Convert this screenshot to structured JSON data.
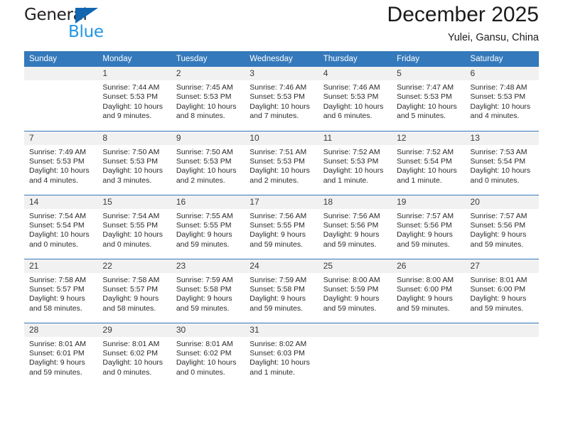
{
  "brand": {
    "name_top": "General",
    "name_bottom": "Blue",
    "accent_color": "#1266b0",
    "blue_text_color": "#2196e3"
  },
  "header": {
    "title": "December 2025",
    "subtitle": "Yulei, Gansu, China"
  },
  "calendar": {
    "header_bg": "#3479bb",
    "daynum_bg": "#f1f1f1",
    "weekday_headers": [
      "Sunday",
      "Monday",
      "Tuesday",
      "Wednesday",
      "Thursday",
      "Friday",
      "Saturday"
    ],
    "weeks": [
      [
        {
          "day": "",
          "sunrise": "",
          "sunset": "",
          "daylight1": "",
          "daylight2": ""
        },
        {
          "day": "1",
          "sunrise": "Sunrise: 7:44 AM",
          "sunset": "Sunset: 5:53 PM",
          "daylight1": "Daylight: 10 hours",
          "daylight2": "and 9 minutes."
        },
        {
          "day": "2",
          "sunrise": "Sunrise: 7:45 AM",
          "sunset": "Sunset: 5:53 PM",
          "daylight1": "Daylight: 10 hours",
          "daylight2": "and 8 minutes."
        },
        {
          "day": "3",
          "sunrise": "Sunrise: 7:46 AM",
          "sunset": "Sunset: 5:53 PM",
          "daylight1": "Daylight: 10 hours",
          "daylight2": "and 7 minutes."
        },
        {
          "day": "4",
          "sunrise": "Sunrise: 7:46 AM",
          "sunset": "Sunset: 5:53 PM",
          "daylight1": "Daylight: 10 hours",
          "daylight2": "and 6 minutes."
        },
        {
          "day": "5",
          "sunrise": "Sunrise: 7:47 AM",
          "sunset": "Sunset: 5:53 PM",
          "daylight1": "Daylight: 10 hours",
          "daylight2": "and 5 minutes."
        },
        {
          "day": "6",
          "sunrise": "Sunrise: 7:48 AM",
          "sunset": "Sunset: 5:53 PM",
          "daylight1": "Daylight: 10 hours",
          "daylight2": "and 4 minutes."
        }
      ],
      [
        {
          "day": "7",
          "sunrise": "Sunrise: 7:49 AM",
          "sunset": "Sunset: 5:53 PM",
          "daylight1": "Daylight: 10 hours",
          "daylight2": "and 4 minutes."
        },
        {
          "day": "8",
          "sunrise": "Sunrise: 7:50 AM",
          "sunset": "Sunset: 5:53 PM",
          "daylight1": "Daylight: 10 hours",
          "daylight2": "and 3 minutes."
        },
        {
          "day": "9",
          "sunrise": "Sunrise: 7:50 AM",
          "sunset": "Sunset: 5:53 PM",
          "daylight1": "Daylight: 10 hours",
          "daylight2": "and 2 minutes."
        },
        {
          "day": "10",
          "sunrise": "Sunrise: 7:51 AM",
          "sunset": "Sunset: 5:53 PM",
          "daylight1": "Daylight: 10 hours",
          "daylight2": "and 2 minutes."
        },
        {
          "day": "11",
          "sunrise": "Sunrise: 7:52 AM",
          "sunset": "Sunset: 5:53 PM",
          "daylight1": "Daylight: 10 hours",
          "daylight2": "and 1 minute."
        },
        {
          "day": "12",
          "sunrise": "Sunrise: 7:52 AM",
          "sunset": "Sunset: 5:54 PM",
          "daylight1": "Daylight: 10 hours",
          "daylight2": "and 1 minute."
        },
        {
          "day": "13",
          "sunrise": "Sunrise: 7:53 AM",
          "sunset": "Sunset: 5:54 PM",
          "daylight1": "Daylight: 10 hours",
          "daylight2": "and 0 minutes."
        }
      ],
      [
        {
          "day": "14",
          "sunrise": "Sunrise: 7:54 AM",
          "sunset": "Sunset: 5:54 PM",
          "daylight1": "Daylight: 10 hours",
          "daylight2": "and 0 minutes."
        },
        {
          "day": "15",
          "sunrise": "Sunrise: 7:54 AM",
          "sunset": "Sunset: 5:55 PM",
          "daylight1": "Daylight: 10 hours",
          "daylight2": "and 0 minutes."
        },
        {
          "day": "16",
          "sunrise": "Sunrise: 7:55 AM",
          "sunset": "Sunset: 5:55 PM",
          "daylight1": "Daylight: 9 hours",
          "daylight2": "and 59 minutes."
        },
        {
          "day": "17",
          "sunrise": "Sunrise: 7:56 AM",
          "sunset": "Sunset: 5:55 PM",
          "daylight1": "Daylight: 9 hours",
          "daylight2": "and 59 minutes."
        },
        {
          "day": "18",
          "sunrise": "Sunrise: 7:56 AM",
          "sunset": "Sunset: 5:56 PM",
          "daylight1": "Daylight: 9 hours",
          "daylight2": "and 59 minutes."
        },
        {
          "day": "19",
          "sunrise": "Sunrise: 7:57 AM",
          "sunset": "Sunset: 5:56 PM",
          "daylight1": "Daylight: 9 hours",
          "daylight2": "and 59 minutes."
        },
        {
          "day": "20",
          "sunrise": "Sunrise: 7:57 AM",
          "sunset": "Sunset: 5:56 PM",
          "daylight1": "Daylight: 9 hours",
          "daylight2": "and 59 minutes."
        }
      ],
      [
        {
          "day": "21",
          "sunrise": "Sunrise: 7:58 AM",
          "sunset": "Sunset: 5:57 PM",
          "daylight1": "Daylight: 9 hours",
          "daylight2": "and 58 minutes."
        },
        {
          "day": "22",
          "sunrise": "Sunrise: 7:58 AM",
          "sunset": "Sunset: 5:57 PM",
          "daylight1": "Daylight: 9 hours",
          "daylight2": "and 58 minutes."
        },
        {
          "day": "23",
          "sunrise": "Sunrise: 7:59 AM",
          "sunset": "Sunset: 5:58 PM",
          "daylight1": "Daylight: 9 hours",
          "daylight2": "and 59 minutes."
        },
        {
          "day": "24",
          "sunrise": "Sunrise: 7:59 AM",
          "sunset": "Sunset: 5:58 PM",
          "daylight1": "Daylight: 9 hours",
          "daylight2": "and 59 minutes."
        },
        {
          "day": "25",
          "sunrise": "Sunrise: 8:00 AM",
          "sunset": "Sunset: 5:59 PM",
          "daylight1": "Daylight: 9 hours",
          "daylight2": "and 59 minutes."
        },
        {
          "day": "26",
          "sunrise": "Sunrise: 8:00 AM",
          "sunset": "Sunset: 6:00 PM",
          "daylight1": "Daylight: 9 hours",
          "daylight2": "and 59 minutes."
        },
        {
          "day": "27",
          "sunrise": "Sunrise: 8:01 AM",
          "sunset": "Sunset: 6:00 PM",
          "daylight1": "Daylight: 9 hours",
          "daylight2": "and 59 minutes."
        }
      ],
      [
        {
          "day": "28",
          "sunrise": "Sunrise: 8:01 AM",
          "sunset": "Sunset: 6:01 PM",
          "daylight1": "Daylight: 9 hours",
          "daylight2": "and 59 minutes."
        },
        {
          "day": "29",
          "sunrise": "Sunrise: 8:01 AM",
          "sunset": "Sunset: 6:02 PM",
          "daylight1": "Daylight: 10 hours",
          "daylight2": "and 0 minutes."
        },
        {
          "day": "30",
          "sunrise": "Sunrise: 8:01 AM",
          "sunset": "Sunset: 6:02 PM",
          "daylight1": "Daylight: 10 hours",
          "daylight2": "and 0 minutes."
        },
        {
          "day": "31",
          "sunrise": "Sunrise: 8:02 AM",
          "sunset": "Sunset: 6:03 PM",
          "daylight1": "Daylight: 10 hours",
          "daylight2": "and 1 minute."
        },
        {
          "day": "",
          "sunrise": "",
          "sunset": "",
          "daylight1": "",
          "daylight2": ""
        },
        {
          "day": "",
          "sunrise": "",
          "sunset": "",
          "daylight1": "",
          "daylight2": ""
        },
        {
          "day": "",
          "sunrise": "",
          "sunset": "",
          "daylight1": "",
          "daylight2": ""
        }
      ]
    ]
  }
}
